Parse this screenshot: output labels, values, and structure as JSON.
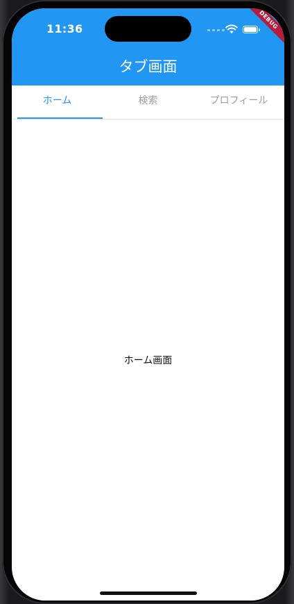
{
  "status_bar": {
    "time": "11:36",
    "icons": [
      "signal-dots-icon",
      "wifi-icon",
      "battery-icon"
    ]
  },
  "debug_banner": "DEBUG",
  "app_bar": {
    "title": "タブ画面",
    "color": "#2196F3"
  },
  "tabs": [
    {
      "label": "ホーム",
      "active": true
    },
    {
      "label": "検索",
      "active": false
    },
    {
      "label": "プロフィール",
      "active": false
    }
  ],
  "content": {
    "text": "ホーム画面"
  },
  "colors": {
    "accent": "#2196F3",
    "inactive_tab": "#9e9e9e",
    "debug": "#B71C3B"
  }
}
